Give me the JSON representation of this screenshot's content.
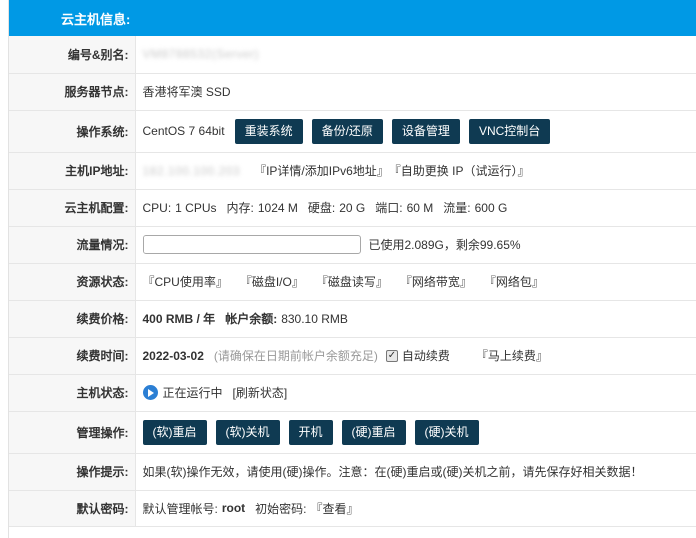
{
  "header": {
    "title": "云主机信息:"
  },
  "rows": {
    "id_alias": {
      "label": "编号&别名:",
      "value": "VM8788532(Server)"
    },
    "node": {
      "label": "服务器节点:",
      "value": "香港将军澳 SSD"
    },
    "os": {
      "label": "操作系统:",
      "value": "CentOS 7 64bit",
      "buttons": [
        "重装系统",
        "备份/还原",
        "设备管理",
        "VNC控制台"
      ]
    },
    "ip": {
      "label": "主机IP地址:",
      "value": "182.100.100.203",
      "links": [
        "『IP详情/添加IPv6地址』",
        "『自助更换 IP（试运行）』"
      ]
    },
    "config": {
      "label": "云主机配置:",
      "cpu_label": "CPU:",
      "cpu_value": "1 CPUs",
      "mem_label": "内存:",
      "mem_value": "1024 M",
      "disk_label": "硬盘:",
      "disk_value": "20 G",
      "port_label": "端口:",
      "port_value": "60 M",
      "traffic_label": "流量:",
      "traffic_value": "600 G"
    },
    "traffic": {
      "label": "流量情况:",
      "used_fraction": 0.0035,
      "text": "已使用2.089G，剩余99.65%"
    },
    "resource": {
      "label": "资源状态:",
      "links": [
        "『CPU使用率』",
        "『磁盘I/O』",
        "『磁盘读写』",
        "『网络带宽』",
        "『网络包』"
      ]
    },
    "price": {
      "label": "续费价格:",
      "value": "400 RMB / 年",
      "balance_label": "帐户余额:",
      "balance_value": "830.10 RMB"
    },
    "renew": {
      "label": "续费时间:",
      "date": "2022-03-02",
      "note": "(请确保在日期前帐户余额充足)",
      "auto_label": "自动续费",
      "renew_link": "『马上续费』"
    },
    "status": {
      "label": "主机状态:",
      "value": "正在运行中",
      "refresh": "[刷新状态]"
    },
    "manage": {
      "label": "管理操作:",
      "buttons": [
        "(软)重启",
        "(软)关机",
        "开机",
        "(硬)重启",
        "(硬)关机"
      ]
    },
    "tip": {
      "label": "操作提示:",
      "value": "如果(软)操作无效，请使用(硬)操作。注意：在(硬)重启或(硬)关机之前，请先保存好相关数据！"
    },
    "password": {
      "label": "默认密码:",
      "account_label": "默认管理帐号:",
      "account_value": "root",
      "pwd_label": "初始密码:",
      "view_link": "『查看』"
    }
  },
  "colors": {
    "header": "#0099e5",
    "button": "#0f3a52",
    "status_icon": "#2b7fd4"
  }
}
